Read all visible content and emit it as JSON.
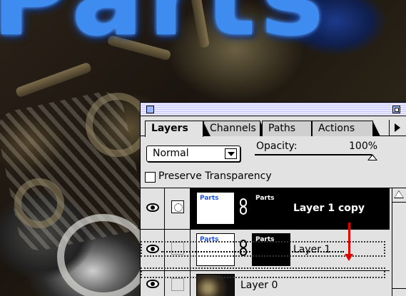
{
  "background": {
    "title_text": "Parts",
    "title_color": "#3f8cf0"
  },
  "palette": {
    "tabs": [
      {
        "label": "Layers",
        "active": true
      },
      {
        "label": "Channels",
        "active": false
      },
      {
        "label": "Paths",
        "active": false
      },
      {
        "label": "Actions",
        "active": false
      }
    ],
    "blend_mode": "Normal",
    "opacity_label": "Opacity:",
    "opacity_value": "100%",
    "opacity_fraction": 1.0,
    "preserve_transparency_label": "Preserve Transparency",
    "preserve_transparency_checked": false,
    "layers": [
      {
        "name": "Layer 1 copy",
        "selected": true,
        "visible": true,
        "thumb_text": "Parts",
        "mask_text": "Parts"
      },
      {
        "name": "Layer 1",
        "selected": false,
        "visible": true,
        "thumb_text": "Parts",
        "mask_text": "Parts"
      },
      {
        "name": "Layer 0",
        "selected": false,
        "visible": true
      }
    ]
  },
  "colors": {
    "drag_arrow": "#e00000",
    "selected_row": "#000000",
    "palette_bg": "#e2e2e2"
  }
}
